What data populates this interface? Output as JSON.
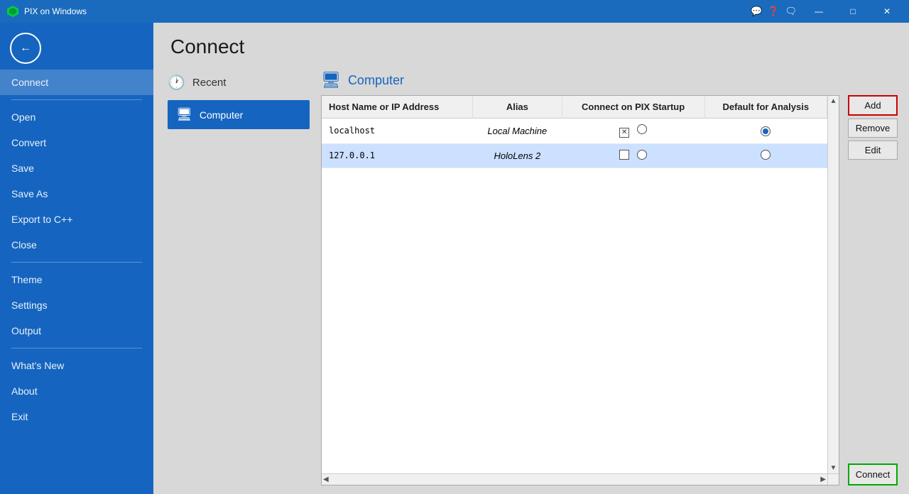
{
  "titlebar": {
    "title": "PIX on Windows",
    "icon": "🟩",
    "controls": {
      "minimize": "—",
      "maximize": "□",
      "close": "✕"
    }
  },
  "sidebar": {
    "items": [
      {
        "id": "connect",
        "label": "Connect",
        "active": true
      },
      {
        "id": "divider1"
      },
      {
        "id": "open",
        "label": "Open"
      },
      {
        "id": "convert",
        "label": "Convert"
      },
      {
        "id": "save",
        "label": "Save"
      },
      {
        "id": "save-as",
        "label": "Save As"
      },
      {
        "id": "export-cpp",
        "label": "Export to C++"
      },
      {
        "id": "close",
        "label": "Close"
      },
      {
        "id": "divider2"
      },
      {
        "id": "theme",
        "label": "Theme"
      },
      {
        "id": "settings",
        "label": "Settings"
      },
      {
        "id": "output",
        "label": "Output"
      },
      {
        "id": "divider3"
      },
      {
        "id": "whats-new",
        "label": "What's New"
      },
      {
        "id": "about",
        "label": "About"
      },
      {
        "id": "exit",
        "label": "Exit"
      }
    ]
  },
  "page": {
    "title": "Connect"
  },
  "nav": {
    "recent": "Recent",
    "computer": "Computer"
  },
  "panel": {
    "title": "Computer"
  },
  "table": {
    "columns": [
      "Host Name or IP Address",
      "Alias",
      "Connect on PIX Startup",
      "Default for Analysis"
    ],
    "rows": [
      {
        "host": "localhost",
        "alias": "Local Machine",
        "connect_pix": "checked",
        "default_analysis": "radio_filled",
        "selected": false
      },
      {
        "host": "127.0.0.1",
        "alias": "HoloLens 2",
        "connect_pix": "unchecked",
        "default_analysis": "radio_empty",
        "selected": true
      }
    ]
  },
  "buttons": {
    "add": "Add",
    "remove": "Remove",
    "edit": "Edit",
    "connect": "Connect"
  }
}
